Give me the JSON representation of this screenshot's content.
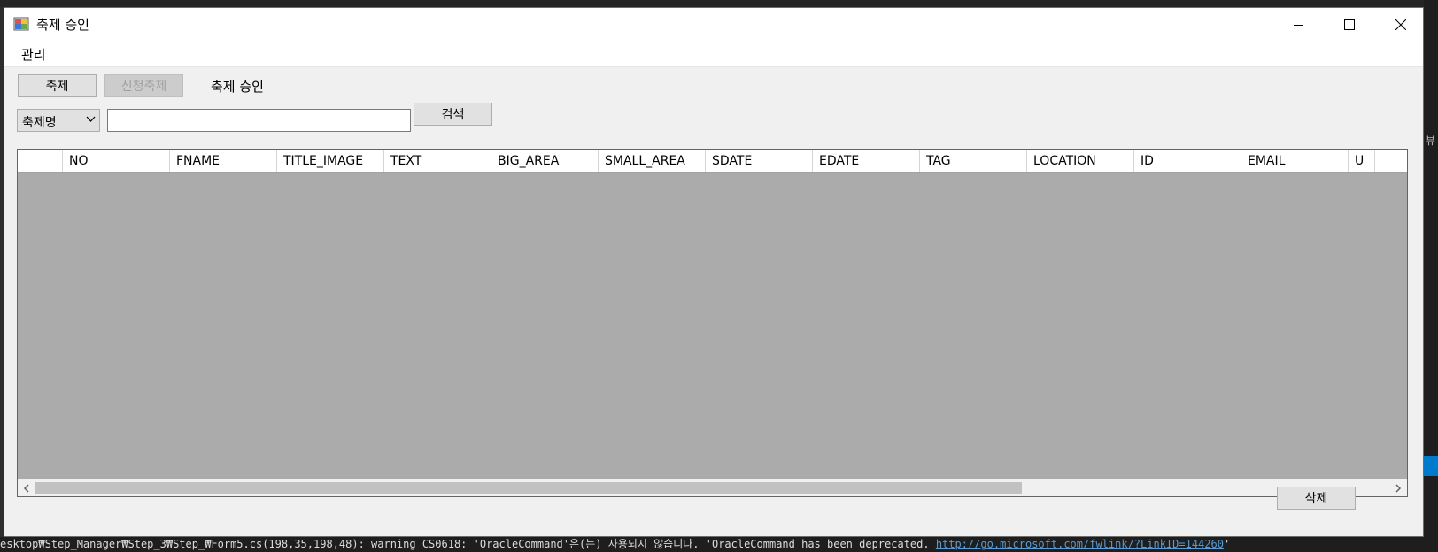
{
  "window": {
    "title": "축제 승인"
  },
  "menu": {
    "items": [
      "관리"
    ]
  },
  "toolbar": {
    "festival_button": "축제",
    "applied_festival_button": "신청축제",
    "section_label": "축제 승인"
  },
  "search": {
    "field_selected": "축제명",
    "input_value": "",
    "button_label": "검색"
  },
  "grid": {
    "columns": [
      "NO",
      "FNAME",
      "TITLE_IMAGE",
      "TEXT",
      "BIG_AREA",
      "SMALL_AREA",
      "SDATE",
      "EDATE",
      "TAG",
      "LOCATION",
      "ID",
      "EMAIL",
      "U"
    ]
  },
  "footer": {
    "delete_button": "삭제"
  },
  "background": {
    "console_text": "esktop₩Step_Manager₩Step_3₩Step_₩Form5.cs(198,35,198,48): warning CS0618: 'OracleCommand'은(는) 사용되지 않습니다. 'OracleCommand has been deprecated. ",
    "console_link": "http://go.microsoft.com/fwlink/?LinkID=144260",
    "console_tail": "'",
    "side_mark": "뷰"
  },
  "colors": {
    "grid_background": "#ababab",
    "window_background": "#f0f0f0",
    "console_background": "#1e1e1e",
    "link_color": "#569cd6"
  }
}
